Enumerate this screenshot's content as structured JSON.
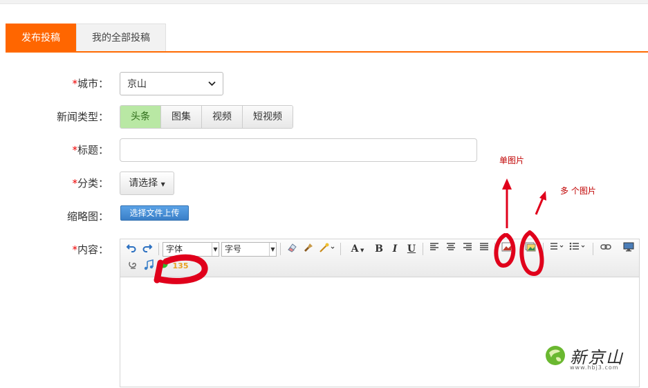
{
  "tabs": [
    {
      "label": "发布投稿",
      "active": true
    },
    {
      "label": "我的全部投稿",
      "active": false
    }
  ],
  "form": {
    "city": {
      "required_mark": "*",
      "label": "城市：",
      "value": "京山"
    },
    "news_type": {
      "label": "新闻类型：",
      "options": [
        "头条",
        "图集",
        "视频",
        "短视频"
      ],
      "selected": "头条"
    },
    "title": {
      "required_mark": "*",
      "label": "标题：",
      "value": ""
    },
    "category": {
      "required_mark": "*",
      "label": "分类：",
      "button": "请选择"
    },
    "thumbnail": {
      "label": "缩略图：",
      "button": "选择文件上传"
    },
    "content": {
      "required_mark": "*",
      "label": "内容："
    }
  },
  "editor": {
    "font_select": "字体",
    "size_select": "字号",
    "icons": [
      "undo-icon",
      "redo-icon",
      "eraser-icon",
      "format-brush-icon",
      "magic-wand-icon",
      "font-color-icon",
      "bold-icon",
      "italic-icon",
      "underline-icon",
      "align-left-icon",
      "align-center-icon",
      "align-right-icon",
      "justify-icon",
      "single-image-icon",
      "multi-image-icon",
      "ordered-list-icon",
      "unordered-list-icon",
      "link-icon",
      "video-icon",
      "emotion-icon",
      "music-icon",
      "wechat-icon",
      "135-icon"
    ],
    "bold_glyph": "B",
    "italic_glyph": "I",
    "underline_glyph": "U",
    "fontcolor_glyph": "A",
    "logo_135": "135"
  },
  "annotations": {
    "single_image": "单图片",
    "multi_image": "多 个图片"
  },
  "watermark": {
    "name": "新京山",
    "url": "www.hbj3.com"
  },
  "colors": {
    "accent": "#ff6600",
    "annotation": "#e0001b",
    "selected_type_bg": "#b9e8a4"
  }
}
